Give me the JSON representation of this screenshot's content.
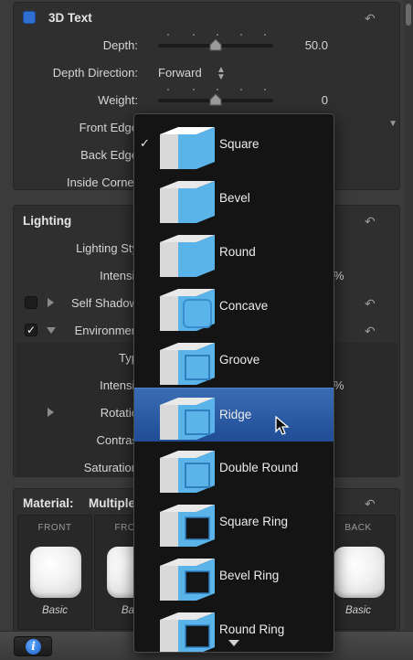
{
  "text3d": {
    "title": "3D Text",
    "depth_label": "Depth:",
    "depth_value": "50.0",
    "depth_level": 0.5,
    "depth_direction_label": "Depth Direction:",
    "depth_direction_value": "Forward",
    "weight_label": "Weight:",
    "weight_value": "0",
    "front_edge_label": "Front Edge",
    "back_edge_label": "Back Edge",
    "inside_corners_label": "Inside Corner"
  },
  "lighting": {
    "title": "Lighting",
    "lighting_style_label": "Lighting Sty",
    "intensity_label": "Intensit",
    "intensity_suffix": "%",
    "self_shadows_label": "Self Shadow",
    "environment_label": "Environmen",
    "env_type_label": "Typ",
    "env_intensity_label": "Intensit",
    "env_intensity_suffix": "%",
    "env_rotation_label": "Rotatio",
    "env_contrast_label": "Contras",
    "env_saturation_label": "Saturation"
  },
  "material": {
    "title_label": "Material:",
    "title_value": "Multiple",
    "columns": [
      {
        "head": "FRONT",
        "name": "Basic"
      },
      {
        "head": "FRONT",
        "name": "Basi"
      },
      {
        "head": "BACK",
        "name": "Basic"
      }
    ]
  },
  "dropdown": {
    "items": [
      {
        "label": "Square",
        "checked": true,
        "selected": false
      },
      {
        "label": "Bevel",
        "checked": false,
        "selected": false
      },
      {
        "label": "Round",
        "checked": false,
        "selected": false
      },
      {
        "label": "Concave",
        "checked": false,
        "selected": false
      },
      {
        "label": "Groove",
        "checked": false,
        "selected": false
      },
      {
        "label": "Ridge",
        "checked": false,
        "selected": true
      },
      {
        "label": "Double Round",
        "checked": false,
        "selected": false
      },
      {
        "label": "Square Ring",
        "checked": false,
        "selected": false
      },
      {
        "label": "Bevel Ring",
        "checked": false,
        "selected": false
      },
      {
        "label": "Round Ring",
        "checked": false,
        "selected": false
      }
    ],
    "check_glyph": "✓"
  },
  "bottom_bar": {
    "info_glyph": "i"
  },
  "colors": {
    "accent_blue": "#2f6fd0",
    "selection": "#2a5aa3",
    "shape_face": "#5ab4ea",
    "shape_side": "#d9d9d9"
  }
}
